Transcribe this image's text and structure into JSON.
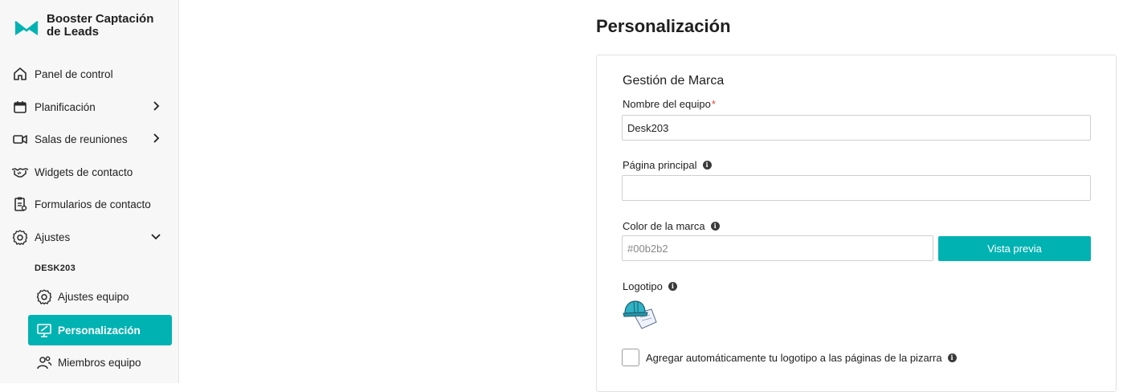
{
  "brand": {
    "name": "Booster Captación de Leads",
    "color": "#00b2b2"
  },
  "sidebar": {
    "items": [
      {
        "label": "Panel de control",
        "icon": "home-icon"
      },
      {
        "label": "Planificación",
        "icon": "calendar-icon",
        "expandable": true
      },
      {
        "label": "Salas de reuniones",
        "icon": "video-icon",
        "expandable": true
      },
      {
        "label": "Widgets de contacto",
        "icon": "handshake-icon"
      },
      {
        "label": "Formularios de contacto",
        "icon": "form-icon"
      },
      {
        "label": "Ajustes",
        "icon": "gear-icon",
        "expanded": true
      }
    ],
    "section_label": "DESK203",
    "sub_items": [
      {
        "label": "Ajustes equipo",
        "icon": "gear-icon",
        "active": false
      },
      {
        "label": "Personalización",
        "icon": "monitor-brush-icon",
        "active": true
      },
      {
        "label": "Miembros equipo",
        "icon": "people-icon",
        "active": false
      }
    ]
  },
  "main": {
    "title": "Personalización",
    "card": {
      "title": "Gestión de Marca",
      "team_name": {
        "label": "Nombre del equipo",
        "required_mark": "*",
        "value": "Desk203"
      },
      "homepage": {
        "label": "Página principal",
        "value": ""
      },
      "brand_color": {
        "label": "Color de la marca",
        "placeholder": "#00b2b2",
        "button_label": "Vista previa"
      },
      "logo": {
        "label": "Logotipo"
      },
      "auto_logo": {
        "label": "Agregar automáticamente tu logotipo a las páginas de la pizarra",
        "checked": false
      }
    }
  }
}
